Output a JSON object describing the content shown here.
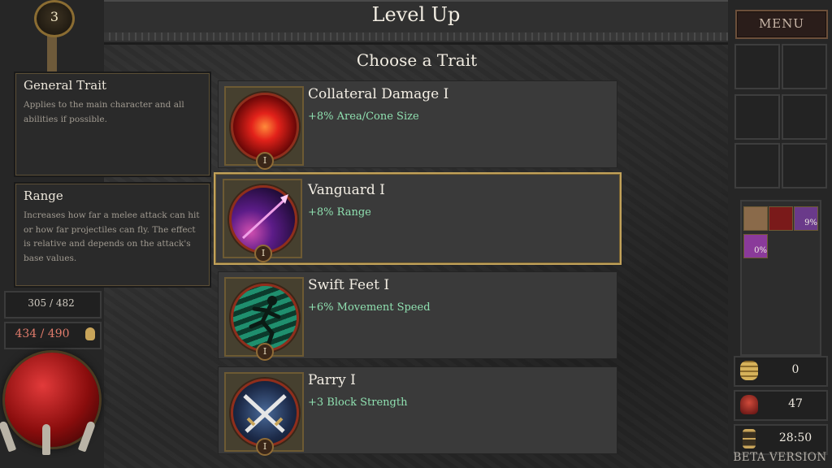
{
  "header": {
    "title": "Level Up",
    "subtitle": "Choose a Trait"
  },
  "left_panel": {
    "level_badge": "3",
    "general_trait": {
      "title": "General Trait",
      "description": "Applies to the main character and all abilities if possible."
    },
    "range_info": {
      "title": "Range",
      "description": "Increases how far a melee attack can hit or how far projectiles can fly. The effect is relative and depends on the attack's base values."
    },
    "experience": "305 / 482",
    "health": "434 / 490"
  },
  "traits": [
    {
      "name": "Collateral Damage I",
      "effect": "+8% Area/Cone Size",
      "level": "I",
      "icon": "fire-ring-icon",
      "selected": false
    },
    {
      "name": "Vanguard I",
      "effect": "+8% Range",
      "level": "I",
      "icon": "spear-thrust-icon",
      "selected": true
    },
    {
      "name": "Swift Feet I",
      "effect": "+6% Movement Speed",
      "level": "I",
      "icon": "running-figure-icon",
      "selected": false
    },
    {
      "name": "Parry I",
      "effect": "+3 Block Strength",
      "level": "I",
      "icon": "crossed-swords-icon",
      "selected": false
    }
  ],
  "right_panel": {
    "menu_label": "MENU",
    "buffs": [
      {
        "icon": "armor-buff-icon",
        "percent": ""
      },
      {
        "icon": "red-demon-buff-icon",
        "percent": ""
      },
      {
        "icon": "purple-beast-buff-icon",
        "percent": "9%"
      },
      {
        "icon": "purple-orb-buff-icon",
        "percent": "0%"
      }
    ],
    "gold": "0",
    "kills": "47",
    "timer": "28:50"
  },
  "footer": {
    "beta_label": "BETA VERSION"
  },
  "colors": {
    "selected_border": "#c2a25a",
    "trait_effect_text": "#8fe0b0",
    "health_text": "#e07b6b",
    "health_orb": "#c21818"
  }
}
